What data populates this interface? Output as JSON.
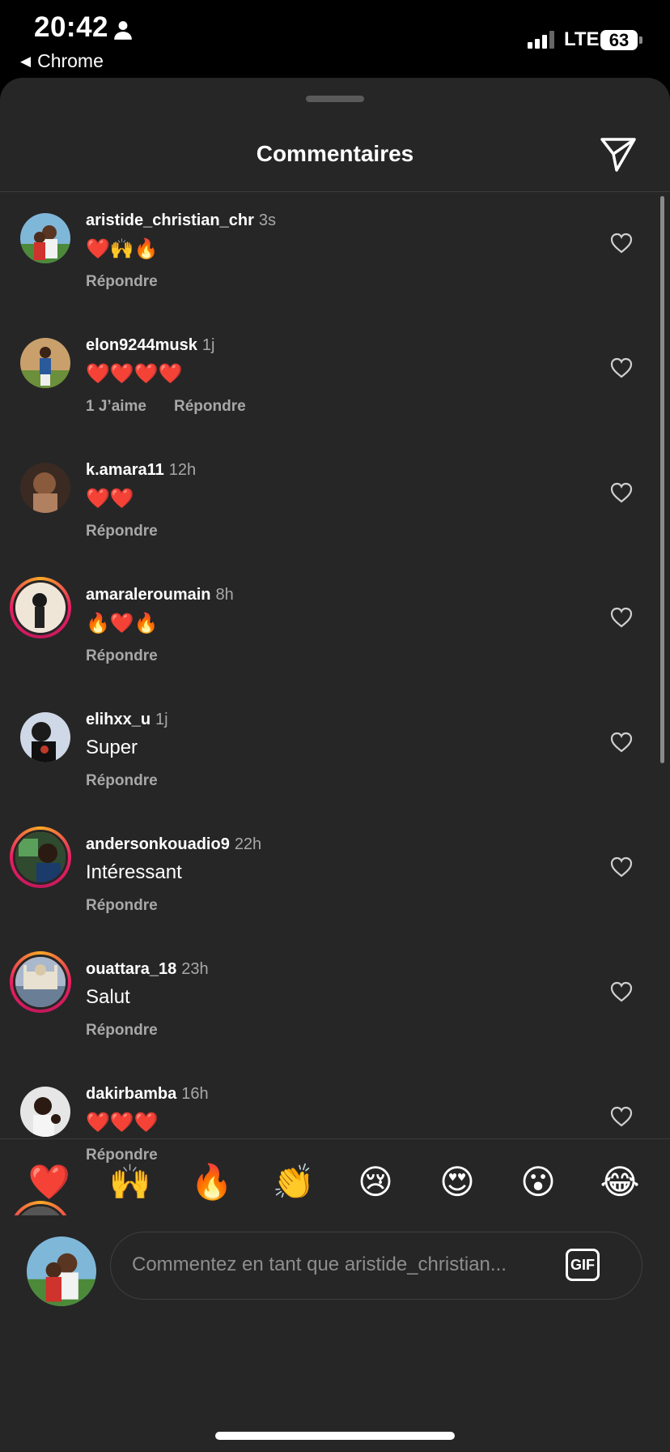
{
  "status_bar": {
    "time": "20:42",
    "back_app": "Chrome",
    "network": "LTE",
    "battery": "63"
  },
  "sheet": {
    "title": "Commentaires"
  },
  "comments": [
    {
      "username": "aristide_christian_chr",
      "age": "3s",
      "text": "❤️🙌🔥",
      "likes": "",
      "reply": "Répondre"
    },
    {
      "username": "elon9244musk",
      "age": "1j",
      "text": "❤️❤️❤️❤️",
      "likes": "1 J’aime",
      "reply": "Répondre"
    },
    {
      "username": "k.amara11",
      "age": "12h",
      "text": "❤️❤️",
      "likes": "",
      "reply": "Répondre"
    },
    {
      "username": "amaraleroumain",
      "age": "8h",
      "text": "🔥❤️🔥",
      "likes": "",
      "reply": "Répondre"
    },
    {
      "username": "elihxx_u",
      "age": "1j",
      "text": "Super",
      "likes": "",
      "reply": "Répondre"
    },
    {
      "username": "andersonkouadio9",
      "age": "22h",
      "text": "Intéressant",
      "likes": "",
      "reply": "Répondre"
    },
    {
      "username": "ouattara_18",
      "age": "23h",
      "text": "Salut",
      "likes": "",
      "reply": "Répondre"
    },
    {
      "username": "dakirbamba",
      "age": "16h",
      "text": "❤️❤️❤️",
      "likes": "",
      "reply": "Répondre"
    }
  ],
  "emoji_bar": [
    "❤️",
    "🙌",
    "🔥",
    "👏",
    "😢",
    "😍",
    "😮",
    "😂"
  ],
  "composer": {
    "placeholder": "Commentez en tant que aristide_christian...",
    "gif_label": "GIF"
  }
}
